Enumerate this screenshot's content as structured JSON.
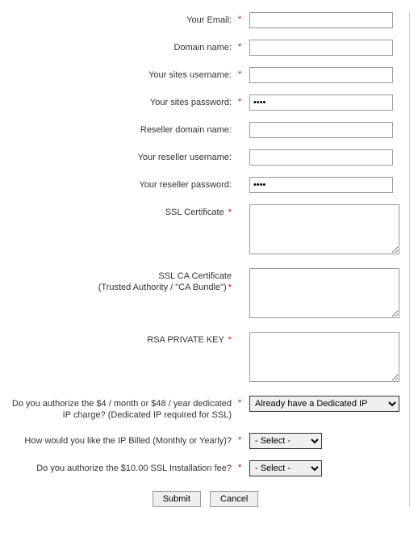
{
  "form": {
    "email_label": "Your Email:",
    "domain_label": "Domain name:",
    "site_user_label": "Your sites username:",
    "site_pass_label": "Your sites password:",
    "site_pass_value": "••••",
    "reseller_domain_label": "Reseller domain name:",
    "reseller_user_label": "Your reseller username:",
    "reseller_pass_label": "Your reseller password:",
    "reseller_pass_value": "••••",
    "ssl_cert_label": "SSL Certificate",
    "ssl_ca_label_line1": "SSL CA Certificate",
    "ssl_ca_label_line2": "(Trusted Authority / \"CA Bundle\")",
    "rsa_key_label": "RSA PRIVATE KEY",
    "ip_auth_label": "Do you authorize the $4 / month or $48 / year dedicated IP charge? (Dedicated IP required for SSL)",
    "ip_auth_selected": "Already have a Dedicated IP",
    "ip_billing_label": "How would you like the IP Billed (Monthly or Yearly)?",
    "ip_billing_selected": "- Select -",
    "ssl_install_label": "Do you authorize the $10.00 SSL Installation fee?",
    "ssl_install_selected": "- Select -",
    "submit_label": "Submit",
    "cancel_label": "Cancel",
    "asterisk": "*"
  }
}
